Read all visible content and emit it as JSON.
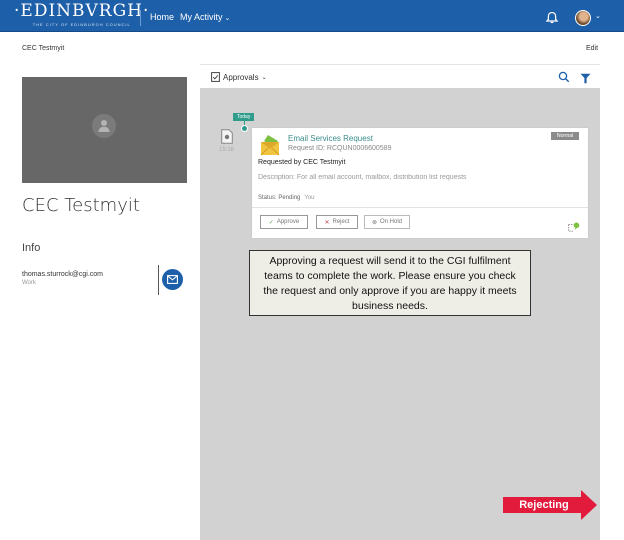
{
  "header": {
    "logo_text": "·EDINBVRGH·",
    "logo_subtitle": "THE CITY OF EDINBURGH COUNCIL",
    "nav": [
      {
        "label": "Home"
      },
      {
        "label": "My Activity",
        "icon": "chevron-down-icon"
      }
    ],
    "icons": [
      "bell-icon",
      "avatar",
      "chevron-down-icon"
    ],
    "chevron": "⌄"
  },
  "breadcrumb": "CEC Testmyit",
  "edit_label": "Edit",
  "profile": {
    "name": "CEC Testmyit",
    "info_heading": "Info",
    "email": "thomas.sturrock@cgi.com",
    "email_type": "Work"
  },
  "feed": {
    "title": "Approvals",
    "chevron": "⌄",
    "today_label": "Today",
    "time": "15:16",
    "card": {
      "title": "Email Services Request",
      "request_id": "Request ID: RCQUN0006600589",
      "priority": "Normal",
      "requested_by": "Requested by CEC Testmyit",
      "description": "Description: For all email account, mailbox, distribution list requests",
      "status": "Status: Pending",
      "status_owner": "You",
      "actions": [
        {
          "label": "Approve",
          "glyph": "✓"
        },
        {
          "label": "Reject",
          "glyph": "✕"
        },
        {
          "label": "On Hold",
          "glyph": "⊗"
        }
      ]
    }
  },
  "annotation": {
    "callout_text": "Approving a request will send it to the CGI fulfilment teams to complete the work. Please ensure you check the request and only approve if you are happy it meets business needs.",
    "arrow_label": "Rejecting",
    "arrow_color": "#e21b3d"
  },
  "colors": {
    "brand_blue": "#1d5fa8",
    "accent_teal": "#2f9c8c",
    "feed_bg": "#d2d2d2"
  }
}
